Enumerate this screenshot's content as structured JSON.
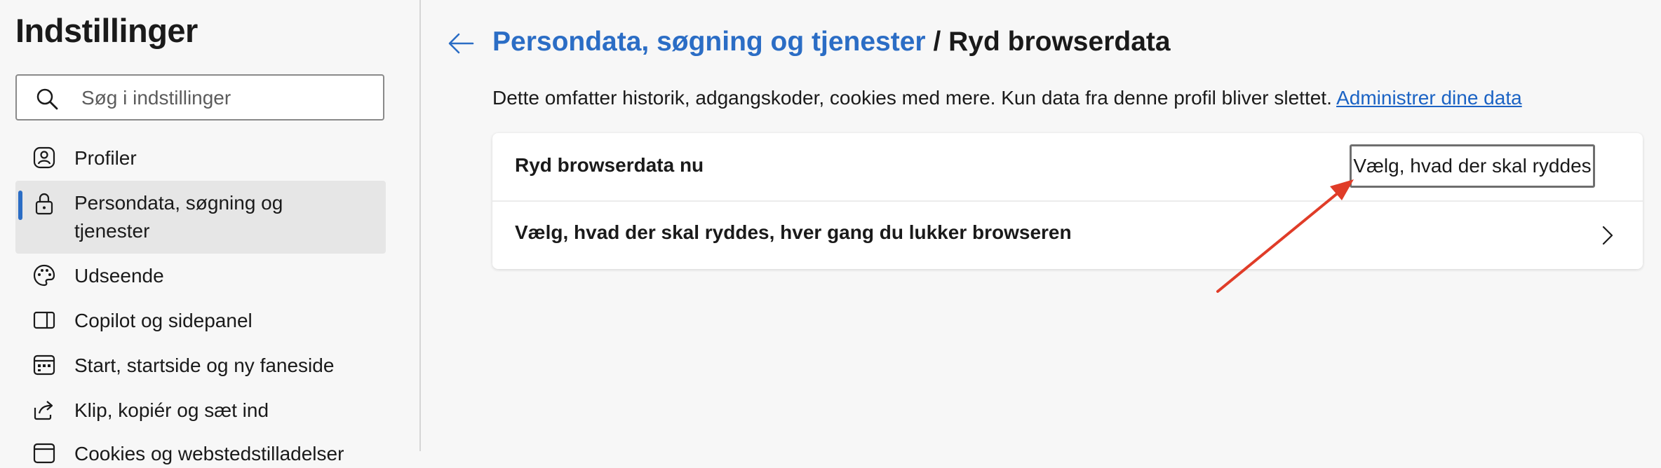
{
  "sidebar": {
    "title": "Indstillinger",
    "search_placeholder": "Søg i indstillinger",
    "items": [
      {
        "label": "Profiler",
        "icon": "profile-icon"
      },
      {
        "label": "Persondata, søgning og tjenester",
        "icon": "lock-icon",
        "selected": true
      },
      {
        "label": "Udseende",
        "icon": "palette-icon"
      },
      {
        "label": "Copilot og sidepanel",
        "icon": "sidepanel-icon"
      },
      {
        "label": "Start, startside og ny faneside",
        "icon": "newtab-icon"
      },
      {
        "label": "Klip, kopiér og sæt ind",
        "icon": "share-icon"
      },
      {
        "label": "Cookies og webstedstilladelser",
        "icon": "cookie-icon"
      }
    ]
  },
  "header": {
    "breadcrumb_parent": "Persondata, søgning og tjenester",
    "breadcrumb_separator": "/",
    "breadcrumb_current": "Ryd browserdata",
    "description": "Dette omfatter historik, adgangskoder, cookies med mere. Kun data fra denne profil bliver slettet.",
    "manage_link": "Administrer dine data"
  },
  "card": {
    "clear_now_label": "Ryd browserdata nu",
    "choose_button": "Vælg, hvad der skal ryddes",
    "on_close_label": "Vælg, hvad der skal ryddes, hver gang du lukker browseren"
  },
  "colors": {
    "accent": "#2b6dc5",
    "link": "#1b63c4",
    "annotation_arrow": "#e03c28",
    "background": "#f7f7f7",
    "selected_bg": "#e6e6e6"
  }
}
